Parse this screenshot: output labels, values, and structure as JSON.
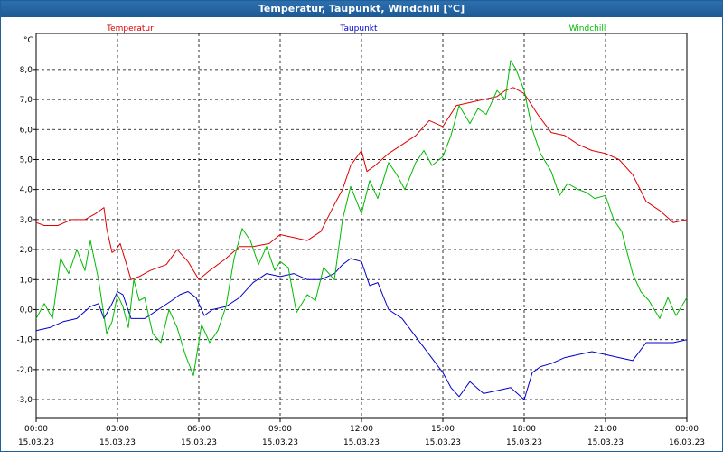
{
  "window": {
    "title": "Temperatur, Taupunkt, Windchill [°C]"
  },
  "chart_data": {
    "type": "line",
    "ylabel": "°C",
    "ylim": [
      -3.6,
      9.2
    ],
    "yticks": [
      -3.0,
      -2.0,
      -1.0,
      0.0,
      1.0,
      2.0,
      3.0,
      4.0,
      5.0,
      6.0,
      7.0,
      8.0
    ],
    "ytick_labels": [
      "-3,0",
      "-2,0",
      "-1,0",
      "0,0",
      "1,0",
      "2,0",
      "3,0",
      "4,0",
      "5,0",
      "6,0",
      "7,0",
      "8,0"
    ],
    "xlim": [
      0,
      24
    ],
    "xticks": [
      0,
      3,
      6,
      9,
      12,
      15,
      18,
      21,
      24
    ],
    "xtick_time": [
      "00:00",
      "03:00",
      "06:00",
      "09:00",
      "12:00",
      "15:00",
      "18:00",
      "21:00",
      "00:00"
    ],
    "xtick_date": [
      "15.03.23",
      "15.03.23",
      "15.03.23",
      "15.03.23",
      "15.03.23",
      "15.03.23",
      "15.03.23",
      "15.03.23",
      "16.03.23"
    ],
    "grid": true,
    "series": [
      {
        "name": "Temperatur",
        "color": "#dd0000",
        "x": [
          0,
          0.3,
          0.8,
          1.3,
          1.8,
          2.2,
          2.5,
          2.6,
          2.8,
          2.95,
          3.1,
          3.3,
          3.5,
          3.8,
          4.2,
          4.8,
          5.2,
          5.6,
          6.0,
          6.4,
          7.0,
          7.5,
          8.0,
          8.6,
          9.0,
          9.5,
          10.0,
          10.5,
          11.0,
          11.3,
          11.6,
          12.0,
          12.2,
          12.5,
          13.0,
          13.5,
          14.0,
          14.5,
          15.0,
          15.5,
          16.0,
          16.5,
          17.0,
          17.3,
          17.6,
          18.0,
          18.5,
          19.0,
          19.5,
          20.0,
          20.5,
          21.0,
          21.5,
          22.0,
          22.5,
          23.0,
          23.5,
          24.0
        ],
        "y": [
          2.9,
          2.8,
          2.8,
          3.0,
          3.0,
          3.2,
          3.4,
          2.7,
          1.9,
          2.0,
          2.2,
          1.6,
          1.0,
          1.1,
          1.3,
          1.5,
          2.0,
          1.6,
          1.0,
          1.3,
          1.7,
          2.1,
          2.1,
          2.2,
          2.5,
          2.4,
          2.3,
          2.6,
          3.5,
          4.0,
          4.8,
          5.3,
          4.6,
          4.8,
          5.2,
          5.5,
          5.8,
          6.3,
          6.1,
          6.8,
          6.9,
          7.0,
          7.1,
          7.3,
          7.4,
          7.2,
          6.5,
          5.9,
          5.8,
          5.5,
          5.3,
          5.2,
          5.0,
          4.5,
          3.6,
          3.3,
          2.9,
          3.0
        ]
      },
      {
        "name": "Taupunkt",
        "color": "#0000cc",
        "x": [
          0,
          0.5,
          1.0,
          1.5,
          2.0,
          2.3,
          2.5,
          2.8,
          3.0,
          3.2,
          3.5,
          4.0,
          4.5,
          5.0,
          5.3,
          5.6,
          5.9,
          6.2,
          6.5,
          7.0,
          7.5,
          8.0,
          8.5,
          9.0,
          9.5,
          10.0,
          10.5,
          11.0,
          11.3,
          11.6,
          12.0,
          12.3,
          12.6,
          13.0,
          13.5,
          14.0,
          14.5,
          15.0,
          15.3,
          15.6,
          16.0,
          16.5,
          17.0,
          17.5,
          18.0,
          18.3,
          18.6,
          19.0,
          19.5,
          20.0,
          20.5,
          21.0,
          21.5,
          22.0,
          22.5,
          23.0,
          23.5,
          24.0
        ],
        "y": [
          -0.7,
          -0.6,
          -0.4,
          -0.3,
          0.1,
          0.2,
          -0.3,
          0.2,
          0.6,
          0.5,
          -0.3,
          -0.3,
          0.0,
          0.3,
          0.5,
          0.6,
          0.4,
          -0.2,
          0.0,
          0.1,
          0.4,
          0.9,
          1.2,
          1.1,
          1.2,
          1.0,
          1.0,
          1.2,
          1.5,
          1.7,
          1.6,
          0.8,
          0.9,
          0.0,
          -0.3,
          -0.9,
          -1.5,
          -2.1,
          -2.6,
          -2.9,
          -2.4,
          -2.8,
          -2.7,
          -2.6,
          -3.0,
          -2.1,
          -1.9,
          -1.8,
          -1.6,
          -1.5,
          -1.4,
          -1.5,
          -1.6,
          -1.7,
          -1.1,
          -1.1,
          -1.1,
          -1.0
        ]
      },
      {
        "name": "Windchill",
        "color": "#00bb00",
        "x": [
          0,
          0.3,
          0.6,
          0.9,
          1.2,
          1.5,
          1.8,
          2.0,
          2.3,
          2.6,
          2.8,
          3.0,
          3.2,
          3.4,
          3.6,
          3.8,
          4.0,
          4.3,
          4.6,
          4.9,
          5.2,
          5.5,
          5.8,
          6.1,
          6.4,
          6.7,
          7.0,
          7.3,
          7.6,
          7.9,
          8.2,
          8.5,
          8.8,
          9.0,
          9.3,
          9.6,
          10.0,
          10.3,
          10.6,
          11.0,
          11.3,
          11.6,
          12.0,
          12.3,
          12.6,
          13.0,
          13.3,
          13.6,
          14.0,
          14.3,
          14.6,
          15.0,
          15.3,
          15.6,
          16.0,
          16.3,
          16.6,
          17.0,
          17.3,
          17.5,
          17.7,
          18.0,
          18.3,
          18.6,
          19.0,
          19.3,
          19.6,
          20.0,
          20.3,
          20.6,
          21.0,
          21.3,
          21.6,
          22.0,
          22.3,
          22.6,
          23.0,
          23.3,
          23.6,
          24.0
        ],
        "y": [
          -0.3,
          0.2,
          -0.3,
          1.7,
          1.2,
          2.0,
          1.3,
          2.3,
          1.0,
          -0.8,
          -0.4,
          0.5,
          0.1,
          -0.6,
          1.0,
          0.3,
          0.4,
          -0.8,
          -1.1,
          0.0,
          -0.6,
          -1.5,
          -2.2,
          -0.5,
          -1.1,
          -0.7,
          0.1,
          1.7,
          2.7,
          2.3,
          1.5,
          2.1,
          1.3,
          1.6,
          1.4,
          -0.1,
          0.5,
          0.3,
          1.4,
          1.0,
          3.0,
          4.1,
          3.2,
          4.3,
          3.7,
          4.9,
          4.5,
          4.0,
          4.9,
          5.3,
          4.8,
          5.1,
          5.8,
          6.8,
          6.2,
          6.7,
          6.5,
          7.3,
          7.0,
          8.3,
          8.0,
          7.3,
          6.0,
          5.2,
          4.6,
          3.8,
          4.2,
          4.0,
          3.9,
          3.7,
          3.8,
          3.0,
          2.6,
          1.2,
          0.6,
          0.3,
          -0.3,
          0.4,
          -0.2,
          0.4
        ]
      }
    ]
  }
}
